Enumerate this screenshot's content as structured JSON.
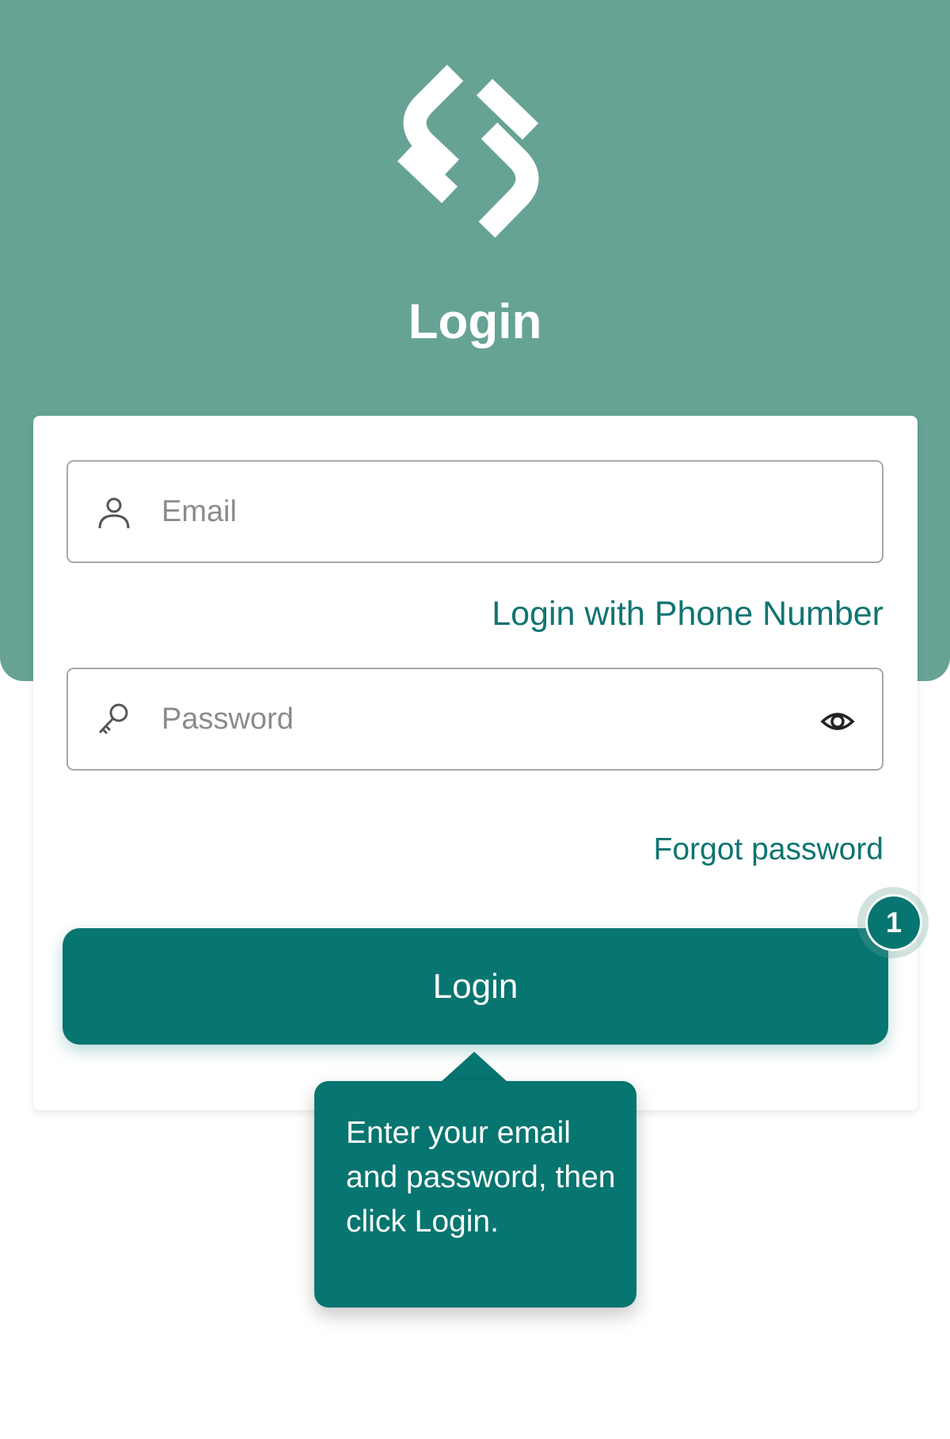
{
  "header": {
    "logo_icon": "brand-s-logo-icon",
    "title": "Login"
  },
  "form": {
    "email": {
      "placeholder": "Email",
      "value": "",
      "icon": "user-icon"
    },
    "phone_login_link": "Login with Phone Number",
    "password": {
      "placeholder": "Password",
      "value": "",
      "icon": "key-icon",
      "toggle_icon": "eye-icon"
    },
    "forgot_password_link": "Forgot password",
    "login_button": "Login"
  },
  "tour": {
    "step_number": "1",
    "tooltip_text": "Enter your email and password, then click Login."
  },
  "colors": {
    "header_bg": "#66a395",
    "primary": "#077570",
    "link": "#0f7571",
    "border": "#a7a7a7",
    "placeholder": "#8c8c8c"
  }
}
